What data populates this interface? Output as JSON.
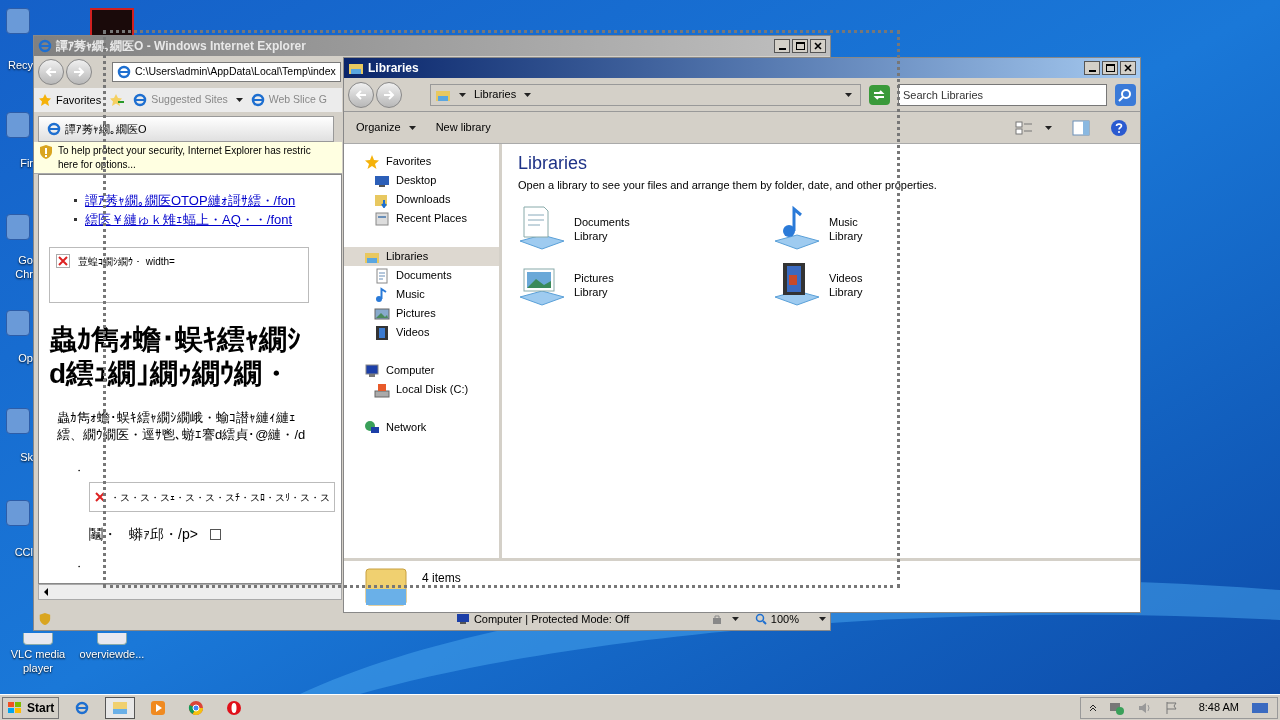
{
  "desktop_icons": [
    {
      "lines": [
        "Recy"
      ]
    },
    {
      "lines": [
        "Fir"
      ]
    },
    {
      "lines": [
        "Go",
        "Chr"
      ]
    },
    {
      "lines": [
        "Op"
      ]
    },
    {
      "lines": [
        "Sk"
      ]
    },
    {
      "lines": [
        "CCl"
      ]
    },
    {
      "lines": [
        "VLC media",
        "player"
      ]
    },
    {
      "lines": [
        "overviewde..."
      ]
    }
  ],
  "ie_window": {
    "title": "譚ｱ莠ｬ繝｡繝医Ο - Windows Internet Explorer",
    "active": false,
    "address": "C:\\Users\\admin\\AppData\\Local\\Temp\\index",
    "favorites_bar": {
      "favorites": "Favorites",
      "links": [
        "Suggested Sites",
        "Web Slice G"
      ]
    },
    "tab": "譚ｱ莠ｬ繝｡繝医Ο",
    "info_bar": [
      "To help protect your security, Internet Explorer has restric",
      "here for options..."
    ],
    "content": {
      "links": [
        "譚ｱ莠ｬ繝｡繝医ΟTOP縺ｫ謌ｻ繧・/fon",
        "繧医￥縺ゅｋ雉ｪ蝠上・AQ・・/font"
      ],
      "broken_image_text": "荳蝗ｺ繝ｼ繝ｳ・ width=",
      "heading": [
        "蟲ｶ雋ｫ蟾･蜈ｷ繧ｬ繝ｼ",
        "d繧ｭ繝｣繝ｩ繝ｳ繝・"
      ],
      "paragraph": [
        "蟲ｶ雋ｫ蟾･蜈ｷ繧ｬ繝ｼ繝峨・蝓ｺ譛ｬ縺ｨ縺ｪ",
        "繧、繝ｳ繝医・逕ｻ鬯､蝣ｴ謇d繧貞･@縺・/d"
      ],
      "bullets": [
        "・",
        "・"
      ],
      "broken_image_text_2": "・ス・ス・スｪ・ス・ス・スﾁ・スﾛ・スﾘ・ス・ス",
      "check_label": [
        "鬮・",
        "蟒ｧ邱・/p>"
      ],
      "checked": false
    },
    "status": {
      "zone": "Computer | Protected Mode: Off",
      "zoom": "100%"
    }
  },
  "explorer_window": {
    "title": "Libraries",
    "active": true,
    "breadcrumb": "Libraries",
    "search": {
      "placeholder": "Search Libraries"
    },
    "toolbar": [
      "Organize",
      "New library"
    ],
    "nav": [
      {
        "label": "Favorites",
        "selected": false,
        "children": [
          {
            "label": "Desktop",
            "selected": false
          },
          {
            "label": "Downloads",
            "selected": false
          },
          {
            "label": "Recent Places",
            "selected": false
          }
        ]
      },
      {
        "label": "Libraries",
        "selected": true,
        "children": [
          {
            "label": "Documents",
            "selected": false
          },
          {
            "label": "Music",
            "selected": false
          },
          {
            "label": "Pictures",
            "selected": false
          },
          {
            "label": "Videos",
            "selected": false
          }
        ]
      },
      {
        "label": "Computer",
        "selected": false,
        "children": [
          {
            "label": "Local Disk (C:)",
            "selected": false
          }
        ]
      },
      {
        "label": "Network",
        "selected": false
      }
    ],
    "heading": "Libraries",
    "description": "Open a library to see your files and arrange them by folder, date, and other properties.",
    "libraries": [
      {
        "name": "Documents",
        "type": "Library"
      },
      {
        "name": "Music",
        "type": "Library"
      },
      {
        "name": "Pictures",
        "type": "Library"
      },
      {
        "name": "Videos",
        "type": "Library"
      }
    ],
    "status": "4 items"
  },
  "taskbar": {
    "start": "Start",
    "apps": [
      {
        "selected": false
      },
      {
        "selected": true
      },
      {
        "selected": false
      },
      {
        "selected": false
      },
      {
        "selected": false
      }
    ],
    "clock": "8:48 AM"
  }
}
